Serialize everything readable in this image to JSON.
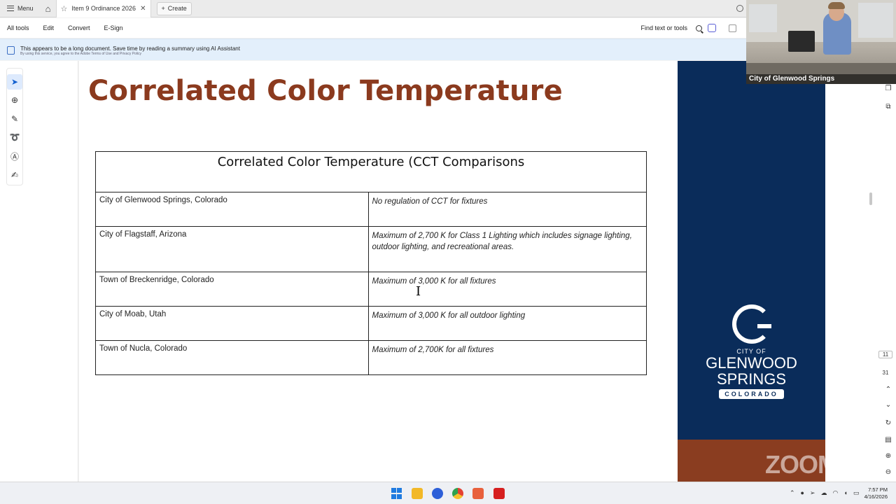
{
  "tabbar": {
    "menu_label": "Menu",
    "tab_title": "Item 9 Ordinance 2026-...",
    "create_label": "Create"
  },
  "toolbar": {
    "items": [
      "All tools",
      "Edit",
      "Convert",
      "E-Sign"
    ],
    "find_placeholder": "Find text or tools"
  },
  "banner": {
    "text": "This appears to be a long document. Save time by reading a summary using AI Assistant",
    "subtext": "By using this service, you agree to the Adobe Terms of Use and Privacy Policy"
  },
  "document": {
    "slide_title": "Correlated Color Temperature",
    "table_header": "Correlated Color Temperature (CCT Comparisons",
    "rows": [
      {
        "place": "City of Glenwood Springs, Colorado",
        "rule": "No regulation of CCT for fixtures"
      },
      {
        "place": "City of Flagstaff, Arizona",
        "rule": "Maximum of 2,700 K for Class 1 Lighting which includes signage lighting, outdoor lighting, and recreational areas."
      },
      {
        "place": "Town of Breckenridge, Colorado",
        "rule": "Maximum of 3,000 K for all fixtures"
      },
      {
        "place": "City of Moab, Utah",
        "rule": "Maximum of 3,000 K for all outdoor lighting"
      },
      {
        "place": "Town of Nucla, Colorado",
        "rule": "Maximum of 2,700K for all fixtures"
      }
    ]
  },
  "logo": {
    "line1": "CITY OF",
    "line2": "GLENWOOD",
    "line3": "SPRINGS",
    "line4": "COLORADO"
  },
  "zoom_watermark": "ZOOM",
  "webcam": {
    "label": "City of Glenwood Springs"
  },
  "page_nav": {
    "current": "11",
    "total": "31"
  },
  "clock": {
    "time": "7:57 PM",
    "date": "4/16/2026"
  },
  "colors": {
    "title": "#8b3a1e",
    "navy": "#0a2c5a",
    "rust": "#8a3d20"
  }
}
